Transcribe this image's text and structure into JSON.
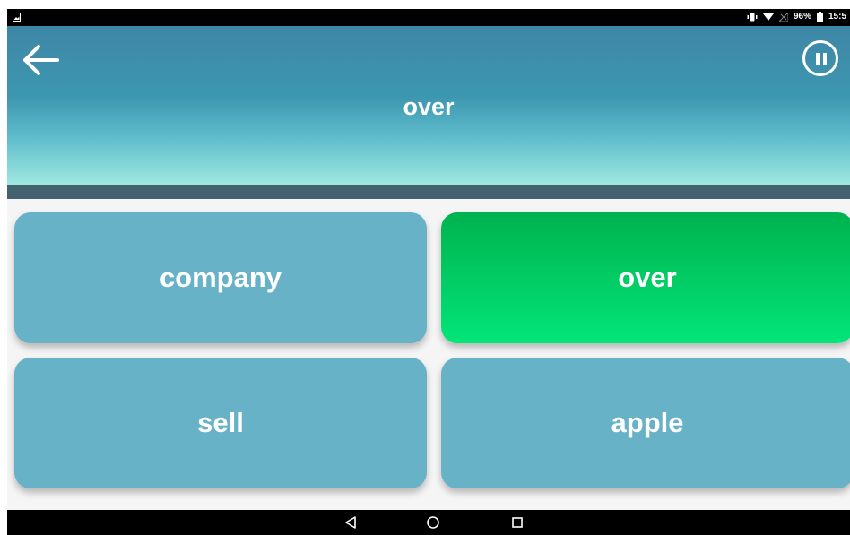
{
  "status_bar": {
    "battery_percent": "96%",
    "time": "15:5"
  },
  "header": {
    "word": "over"
  },
  "answers": [
    {
      "label": "company",
      "state": "default"
    },
    {
      "label": "over",
      "state": "correct"
    },
    {
      "label": "sell",
      "state": "default"
    },
    {
      "label": "apple",
      "state": "default"
    }
  ],
  "colors": {
    "header_top": "#3e87a6",
    "header_bottom": "#9fe8e0",
    "tile_default": "#68b2c7",
    "tile_correct": "#00d066",
    "divider_bar": "#45606e"
  },
  "icons": {
    "back": "arrow-left-icon",
    "pause": "pause-circle-icon",
    "nav_back": "triangle-back-icon",
    "nav_home": "circle-home-icon",
    "nav_recents": "square-recents-icon"
  }
}
